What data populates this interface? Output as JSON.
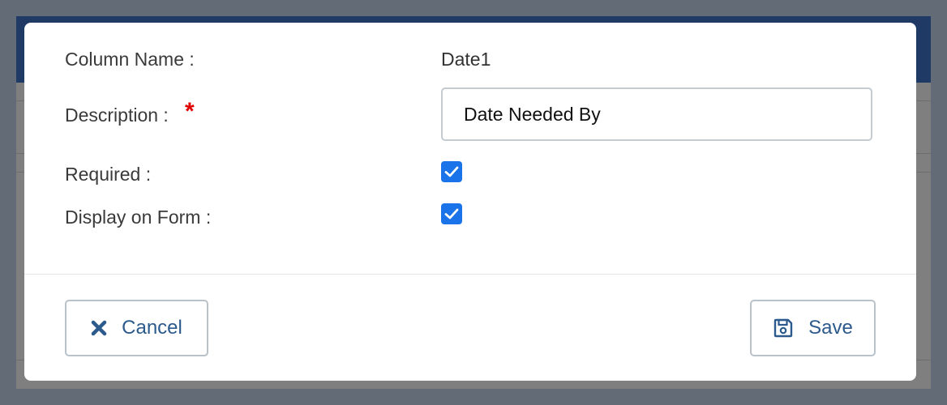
{
  "dialog": {
    "column_name": {
      "label": "Column Name :",
      "value": "Date1"
    },
    "description": {
      "label": "Description :",
      "required_marker": "*",
      "value": "Date Needed By"
    },
    "required": {
      "label": "Required :",
      "checked": true
    },
    "display_on_form": {
      "label": "Display on Form :",
      "checked": true
    }
  },
  "buttons": {
    "cancel_label": "Cancel",
    "cancel_icon": "close-icon",
    "save_label": "Save",
    "save_icon": "floppy-disk-icon"
  },
  "colors": {
    "accent": "#1a73e8",
    "button_text": "#2c5a8c",
    "header_bar": "#203a66",
    "required_star": "#e00000"
  }
}
